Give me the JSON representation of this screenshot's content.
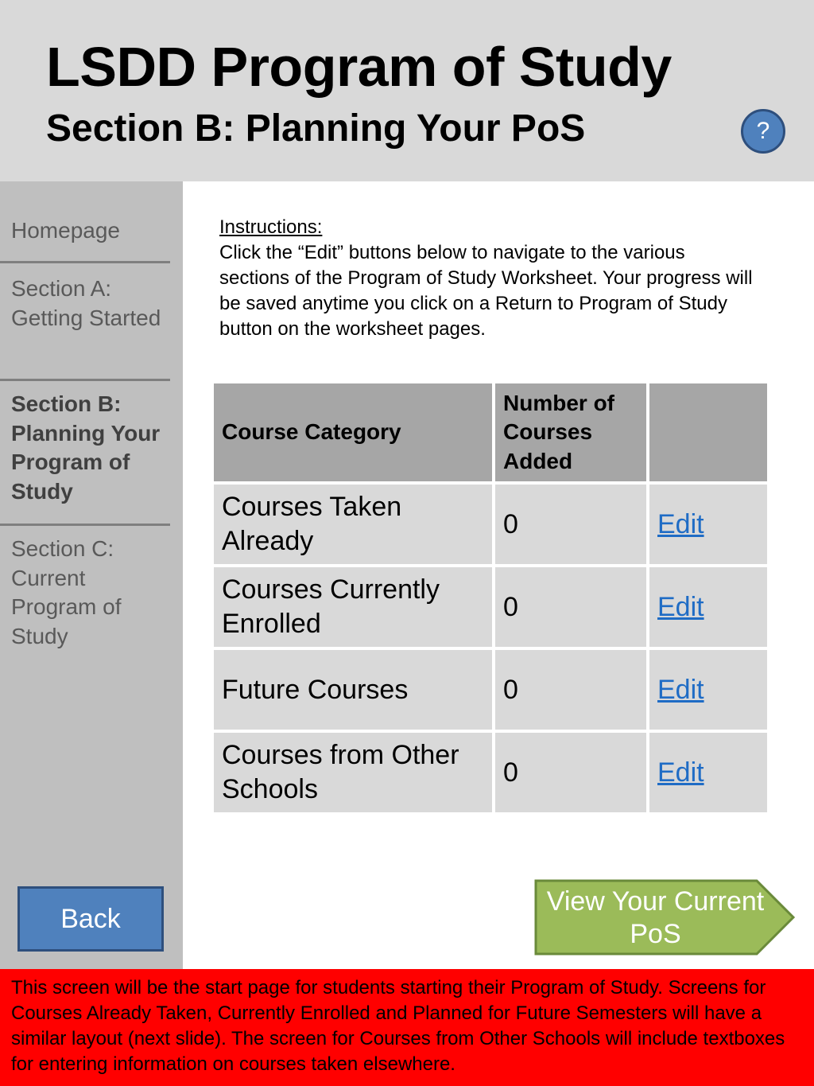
{
  "header": {
    "title": "LSDD Program of Study",
    "subtitle": "Section B: Planning Your PoS",
    "help_label": "?"
  },
  "sidebar": {
    "items": [
      {
        "label": "Homepage",
        "active": false
      },
      {
        "label": "Section A: Getting Started",
        "active": false
      },
      {
        "label": "Section B: Planning Your Program of Study",
        "active": true
      },
      {
        "label": "Section C: Current Program of Study",
        "active": false
      }
    ],
    "back_label": "Back"
  },
  "instructions": {
    "heading": "Instructions:",
    "body": "Click the “Edit” buttons below to navigate to the various sections of the Program of Study Worksheet.  Your progress will be saved anytime you click on a Return to Program of Study button on the worksheet pages."
  },
  "table": {
    "headers": [
      "Course Category",
      "Number of Courses Added",
      ""
    ],
    "rows": [
      {
        "category": "Courses Taken Already",
        "count": "0",
        "action": "Edit"
      },
      {
        "category": "Courses Currently Enrolled",
        "count": "0",
        "action": "Edit"
      },
      {
        "category": "Future Courses",
        "count": "0",
        "action": "Edit"
      },
      {
        "category": "Courses from Other Schools",
        "count": "0",
        "action": "Edit"
      }
    ]
  },
  "view_button": {
    "label": "View Your Current PoS"
  },
  "note": "This screen will be the start page for students starting their Program of Study.  Screens for Courses Already Taken, Currently Enrolled and Planned for Future Semesters will have a similar layout (next slide).  The screen for Courses from Other Schools will include textboxes for entering information on courses taken elsewhere.",
  "colors": {
    "header_bg": "#d9d9d9",
    "sidebar_bg": "#bfbfbf",
    "button_blue": "#4f81bd",
    "arrow_green": "#9bbb59",
    "link_blue": "#1f6cc5",
    "note_red": "#ff0000"
  }
}
